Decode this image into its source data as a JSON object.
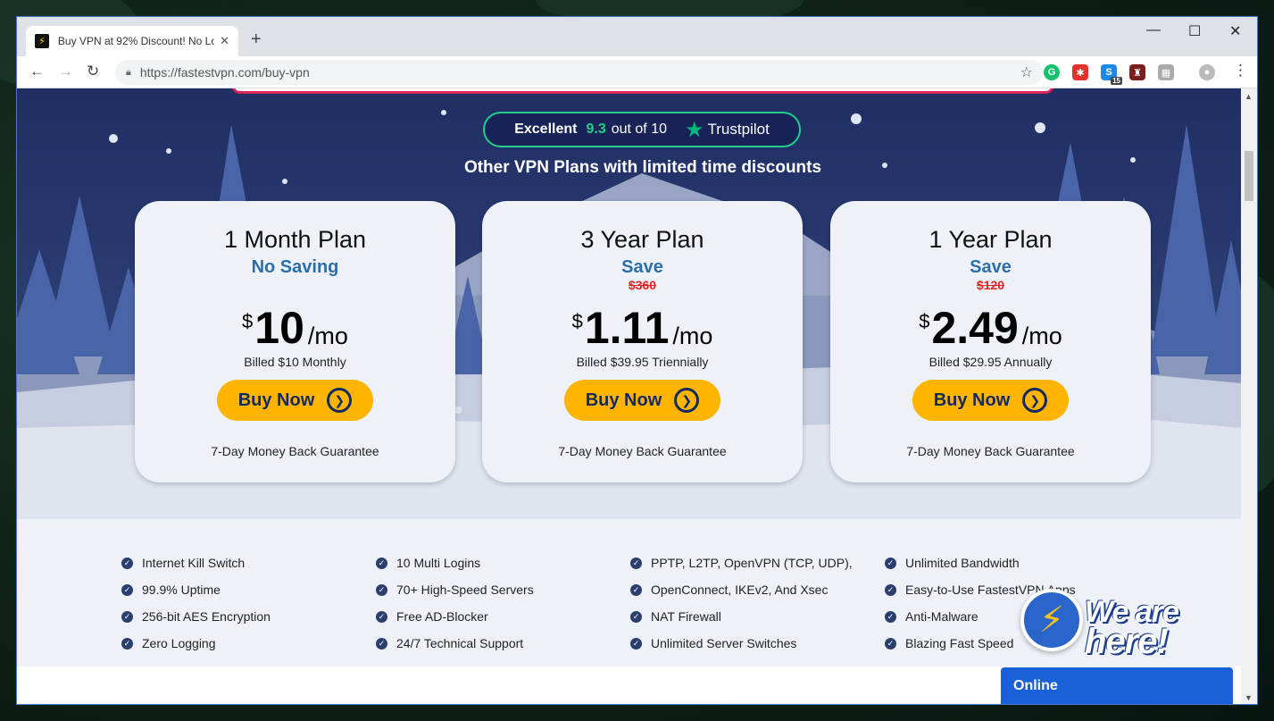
{
  "browser": {
    "tab_title": "Buy VPN at 92% Discount! No Lo",
    "url": "https://fastestvpn.com/buy-vpn",
    "new_tab": "+",
    "ext_badge": "15"
  },
  "trustpilot": {
    "rating_word": "Excellent",
    "score": "9.3",
    "out_of": "out of 10",
    "brand": "Trustpilot"
  },
  "heading": "Other VPN Plans with limited time discounts",
  "plans": [
    {
      "title": "1 Month Plan",
      "save": "No Saving",
      "old_price": "",
      "currency": "$",
      "amount": "10",
      "period": "/mo",
      "billed": "Billed $10 Monthly",
      "button": "Buy Now",
      "guarantee": "7-Day Money Back Guarantee"
    },
    {
      "title": "3 Year Plan",
      "save": "Save",
      "old_price": "$360",
      "currency": "$",
      "amount": "1.11",
      "period": "/mo",
      "billed": "Billed $39.95 Triennially",
      "button": "Buy Now",
      "guarantee": "7-Day Money Back Guarantee"
    },
    {
      "title": "1 Year Plan",
      "save": "Save",
      "old_price": "$120",
      "currency": "$",
      "amount": "2.49",
      "period": "/mo",
      "billed": "Billed $29.95 Annually",
      "button": "Buy Now",
      "guarantee": "7-Day Money Back Guarantee"
    }
  ],
  "features": [
    [
      "Internet Kill Switch",
      "99.9% Uptime",
      "256-bit AES Encryption",
      "Zero Logging"
    ],
    [
      "10 Multi Logins",
      "70+ High-Speed Servers",
      "Free AD-Blocker",
      "24/7 Technical Support"
    ],
    [
      "PPTP, L2TP, OpenVPN (TCP, UDP),",
      "OpenConnect, IKEv2, And Xsec",
      "NAT Firewall",
      "Unlimited Server Switches"
    ],
    [
      "Unlimited Bandwidth",
      "Easy-to-Use FastestVPN Apps",
      "Anti-Malware",
      "Blazing Fast Speed"
    ]
  ],
  "chat": {
    "bubble_text_1": "We are",
    "bubble_text_2": "here!",
    "status": "Online"
  },
  "colors": {
    "accent_button": "#ffb400",
    "trustpilot_green": "#1fcf8a",
    "hero_bg": "#2a3b72",
    "chat_blue": "#1a60d8"
  }
}
